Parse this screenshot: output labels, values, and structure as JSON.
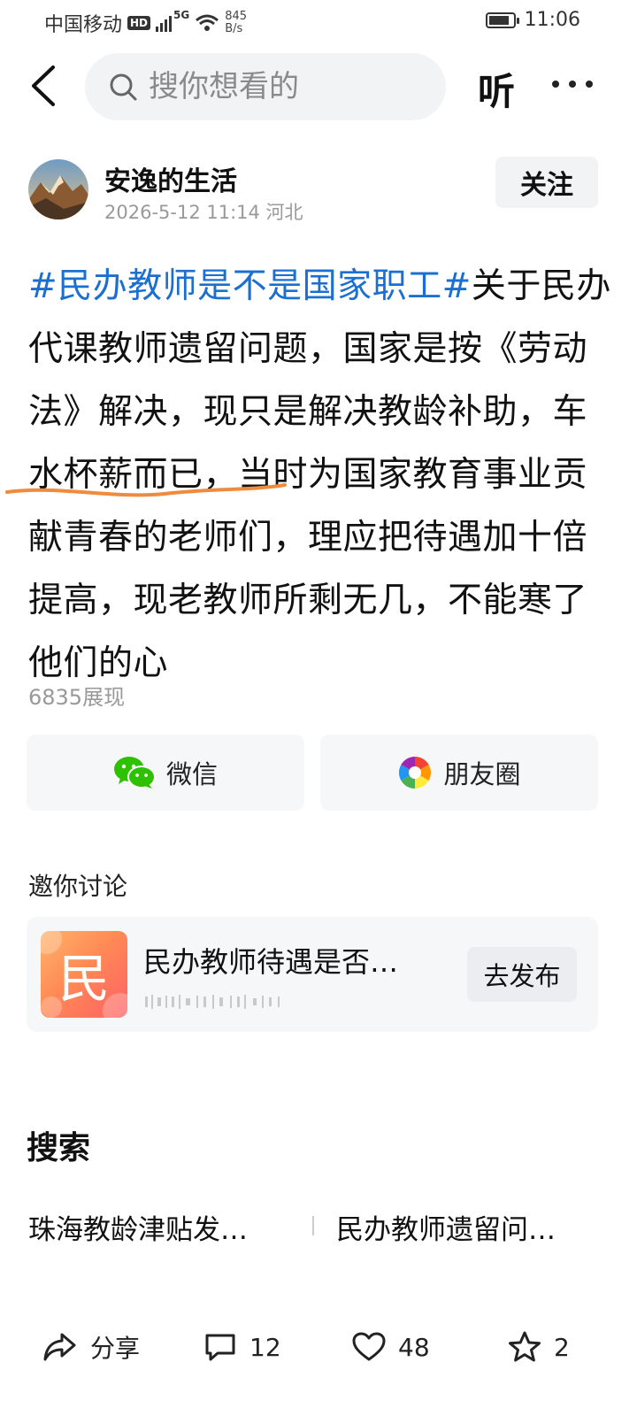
{
  "status_bar": {
    "carrier": "中国移动",
    "hd": "HD",
    "network": "5G",
    "speed_value": "845",
    "speed_unit": "B/s",
    "time": "11:06"
  },
  "header": {
    "search_placeholder": "搜你想看的",
    "listen_label": "听",
    "icons": [
      "back-arrow-icon",
      "search-icon",
      "more-icon"
    ]
  },
  "post": {
    "author": "安逸的生活",
    "meta": "2026-5-12 11:14  河北",
    "follow_label": "关注",
    "topic": "#民办教师是不是国家职工#",
    "body": "关于民办代课教师遗留问题，国家是按《劳动法》解决，现只是解决教龄补助，车水杯薪而已，当时为国家教育事业贡献青春的老师们，理应把待遇加十倍提高，现老教师所剩无几，不能寒了他们的心",
    "views": "6835展现"
  },
  "share": {
    "wechat_label": "微信",
    "moments_label": "朋友圈"
  },
  "discussion": {
    "title": "邀你讨论",
    "tile_char": "民",
    "topic": "民办教师待遇是否…",
    "publish_label": "去发布"
  },
  "search_section": {
    "title": "搜索",
    "suggestions": [
      "珠海教龄津贴发…",
      "民办教师遗留问…"
    ]
  },
  "actions": {
    "share_label": "分享",
    "comments": "12",
    "likes": "48",
    "favorites": "2"
  },
  "colors": {
    "topic_link": "#1a6fd0",
    "underline_mark": "#f08a3c",
    "wechat_green": "#2dc100"
  }
}
